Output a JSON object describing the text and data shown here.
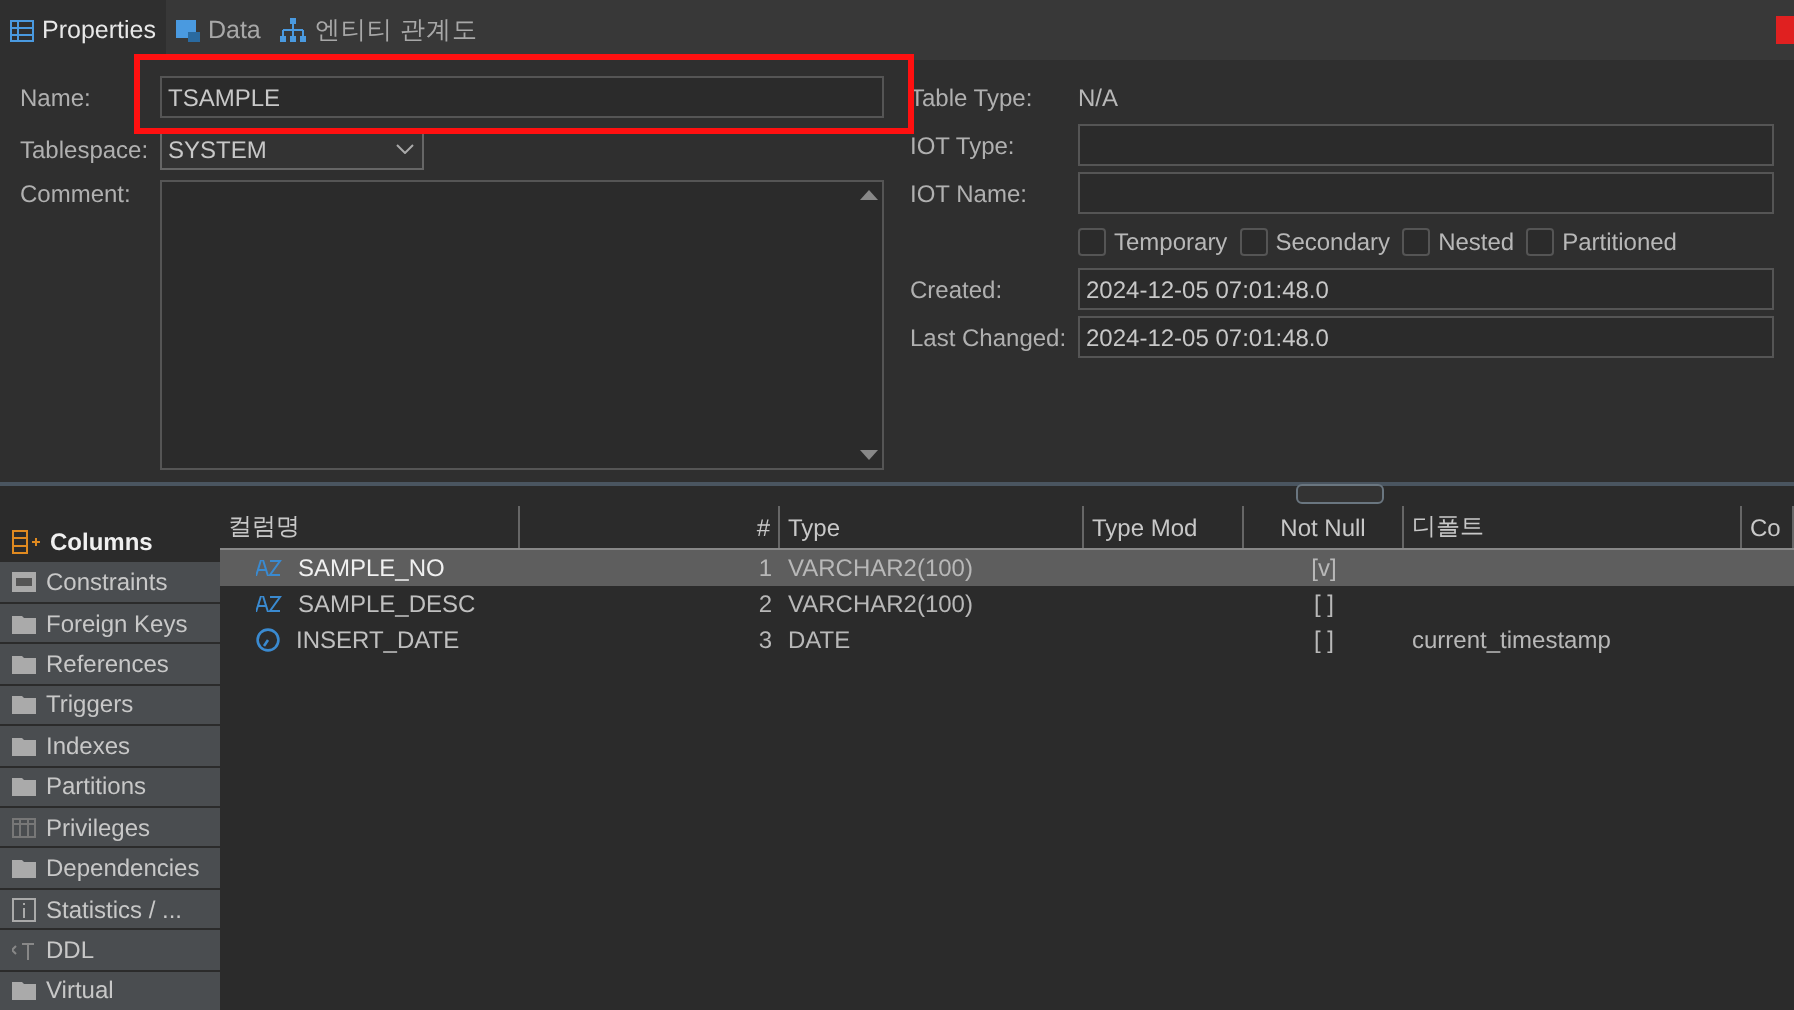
{
  "tabs": [
    {
      "label": "Properties",
      "kind": "table",
      "selected": true
    },
    {
      "label": "Data",
      "kind": "data",
      "selected": false
    },
    {
      "label": "엔티티 관계도",
      "kind": "diagram",
      "selected": false
    }
  ],
  "properties": {
    "name": {
      "label": "Name:",
      "value": "TSAMPLE"
    },
    "tablespace": {
      "label": "Tablespace:",
      "value": "SYSTEM"
    },
    "comment": {
      "label": "Comment:"
    },
    "table_type": {
      "label": "Table Type:",
      "value": "N/A"
    },
    "iot_type": {
      "label": "IOT Type:"
    },
    "iot_name": {
      "label": "IOT Name:"
    },
    "flags": [
      {
        "label": "Temporary",
        "checked": false
      },
      {
        "label": "Secondary",
        "checked": false
      },
      {
        "label": "Nested",
        "checked": false
      },
      {
        "label": "Partitioned",
        "checked": false
      }
    ],
    "created": {
      "label": "Created:",
      "value": "2024-12-05 07:01:48.0"
    },
    "last_changed": {
      "label": "Last Changed:",
      "value": "2024-12-05 07:01:48.0"
    }
  },
  "sidebar": {
    "items": [
      {
        "label": "Columns",
        "kind": "columns",
        "selected": true
      },
      {
        "label": "Constraints",
        "kind": "constraint",
        "selected": false
      },
      {
        "label": "Foreign Keys",
        "kind": "folder",
        "selected": false
      },
      {
        "label": "References",
        "kind": "folder",
        "selected": false
      },
      {
        "label": "Triggers",
        "kind": "folder",
        "selected": false
      },
      {
        "label": "Indexes",
        "kind": "folder",
        "selected": false
      },
      {
        "label": "Partitions",
        "kind": "folder",
        "selected": false
      },
      {
        "label": "Privileges",
        "kind": "grid",
        "selected": false
      },
      {
        "label": "Dependencies",
        "kind": "folder",
        "selected": false
      },
      {
        "label": "Statistics / ...",
        "kind": "info",
        "selected": false
      },
      {
        "label": "DDL",
        "kind": "ddl",
        "selected": false
      },
      {
        "label": "Virtual",
        "kind": "folder",
        "selected": false
      }
    ]
  },
  "table": {
    "columns": [
      "컬럼명",
      "#",
      "Type",
      "Type Mod",
      "Not Null",
      "디폴트",
      "Co"
    ],
    "rows": [
      {
        "kind": "text",
        "name": "SAMPLE_NO",
        "number": "1",
        "type": "VARCHAR2(100)",
        "not_null": "[v]",
        "default": "",
        "selected": true
      },
      {
        "kind": "text",
        "name": "SAMPLE_DESC",
        "number": "2",
        "type": "VARCHAR2(100)",
        "not_null": "[ ]",
        "default": "",
        "selected": false
      },
      {
        "kind": "date",
        "name": "INSERT_DATE",
        "number": "3",
        "type": "DATE",
        "not_null": "[ ]",
        "default": "current_timestamp",
        "selected": false
      }
    ]
  }
}
